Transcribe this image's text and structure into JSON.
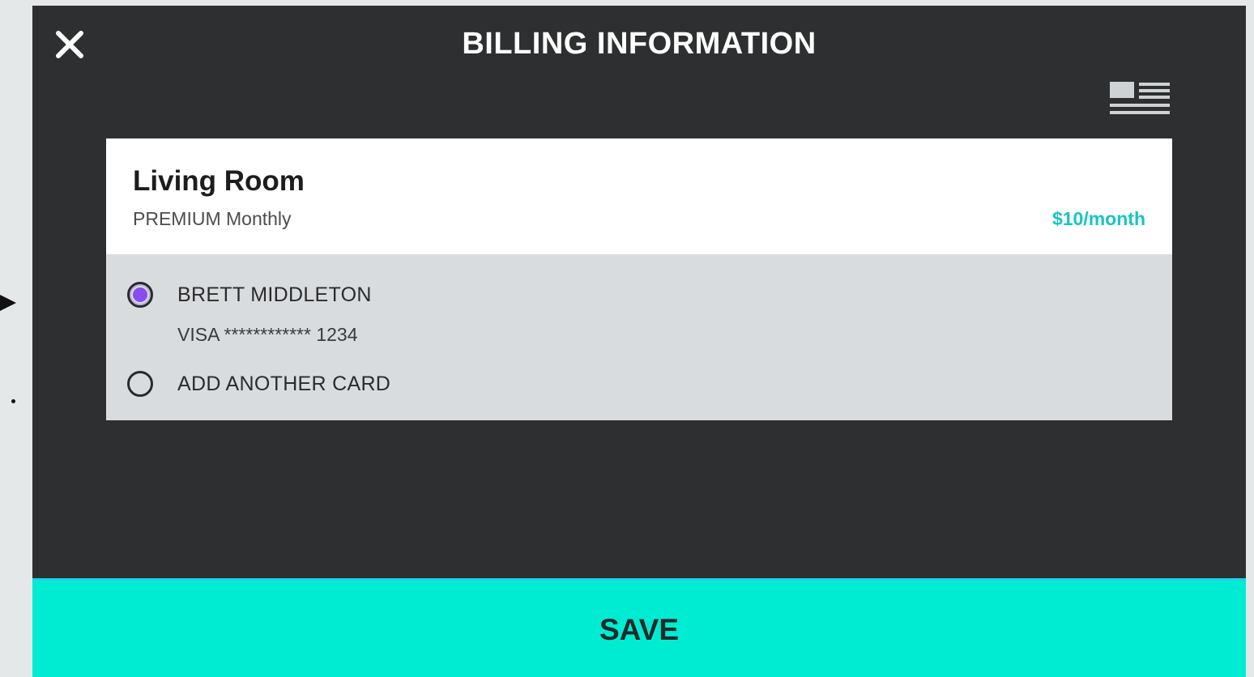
{
  "header": {
    "title": "BILLING INFORMATION",
    "close_icon": "close-icon",
    "view_icon": "list-view-icon"
  },
  "plan": {
    "name": "Living Room",
    "type": "PREMIUM Monthly",
    "price": "$10/month"
  },
  "payment": {
    "options": [
      {
        "label": "BRETT MIDDLETON",
        "detail": "VISA ************ 1234",
        "selected": true
      },
      {
        "label": "ADD ANOTHER CARD",
        "selected": false
      }
    ]
  },
  "footer": {
    "save_label": "SAVE"
  },
  "colors": {
    "modal_bg": "#2d2f30",
    "accent": "#00ecd2",
    "price": "#16c6c2",
    "radio_selected": "#8a4bf0",
    "panel_bg": "#d9dcdf"
  }
}
